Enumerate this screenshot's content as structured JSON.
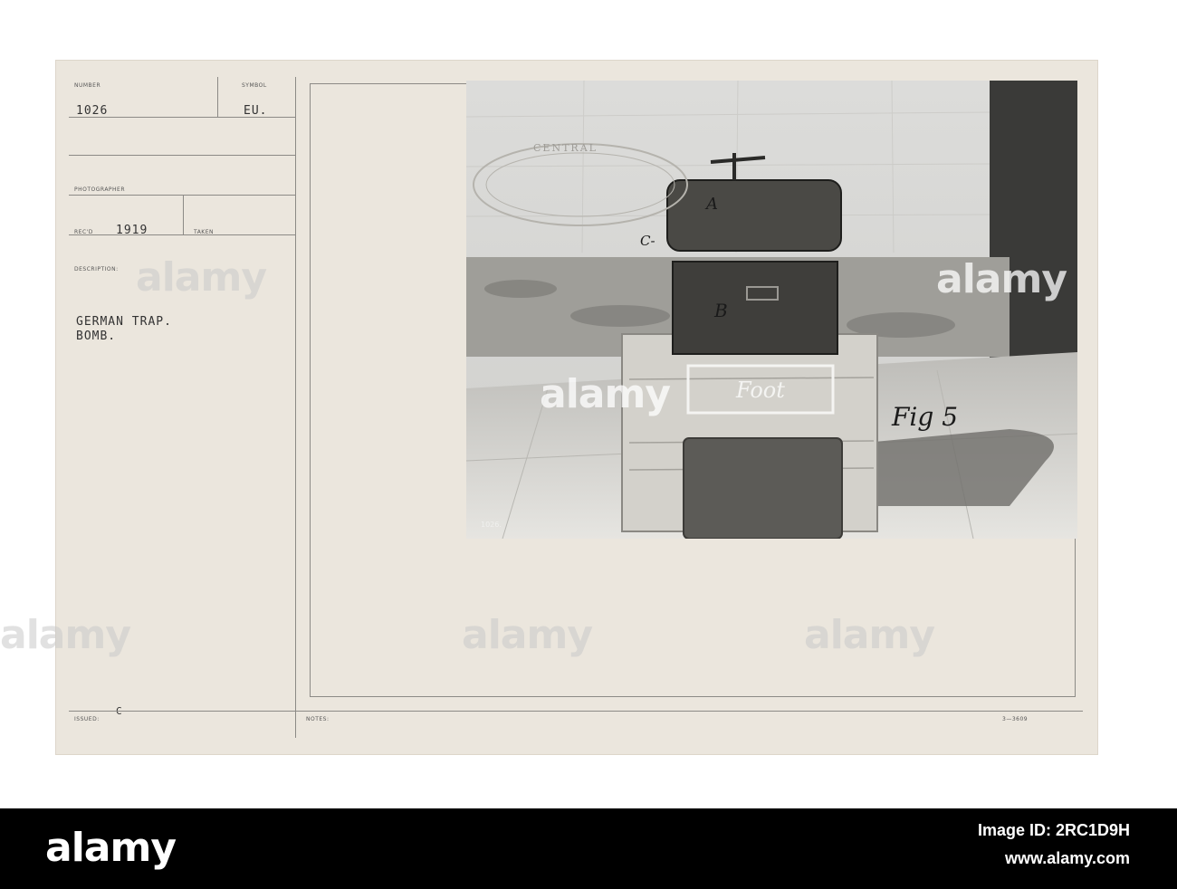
{
  "record": {
    "number_label": "NUMBER",
    "number_value": "1026",
    "symbol_label": "SYMBOL",
    "symbol_value": "EU.",
    "photographer_label": "PHOTOGRAPHER",
    "recd_label": "REC'D",
    "recd_value": "1919",
    "taken_label": "TAKEN",
    "description_label": "DESCRIPTION:",
    "description_line1": "GERMAN TRAP.",
    "description_line2": "BOMB.",
    "issued_label": "ISSUED:",
    "issued_value": "C",
    "notes_label": "NOTES:",
    "form_code": "3—3609"
  },
  "photo": {
    "stamp_text": "CENTRAL",
    "label_a": "A",
    "label_b": "B",
    "label_c": "C-",
    "box_text": "Foot",
    "fig_text": "Fig 5",
    "neg_number": "1026."
  },
  "watermark": {
    "text": "alamy"
  },
  "footer": {
    "brand": "alamy",
    "image_id": "Image ID: 2RC1D9H",
    "site": "www.alamy.com"
  },
  "colors": {
    "card": "#ebe6dd",
    "footer": "#000000"
  }
}
